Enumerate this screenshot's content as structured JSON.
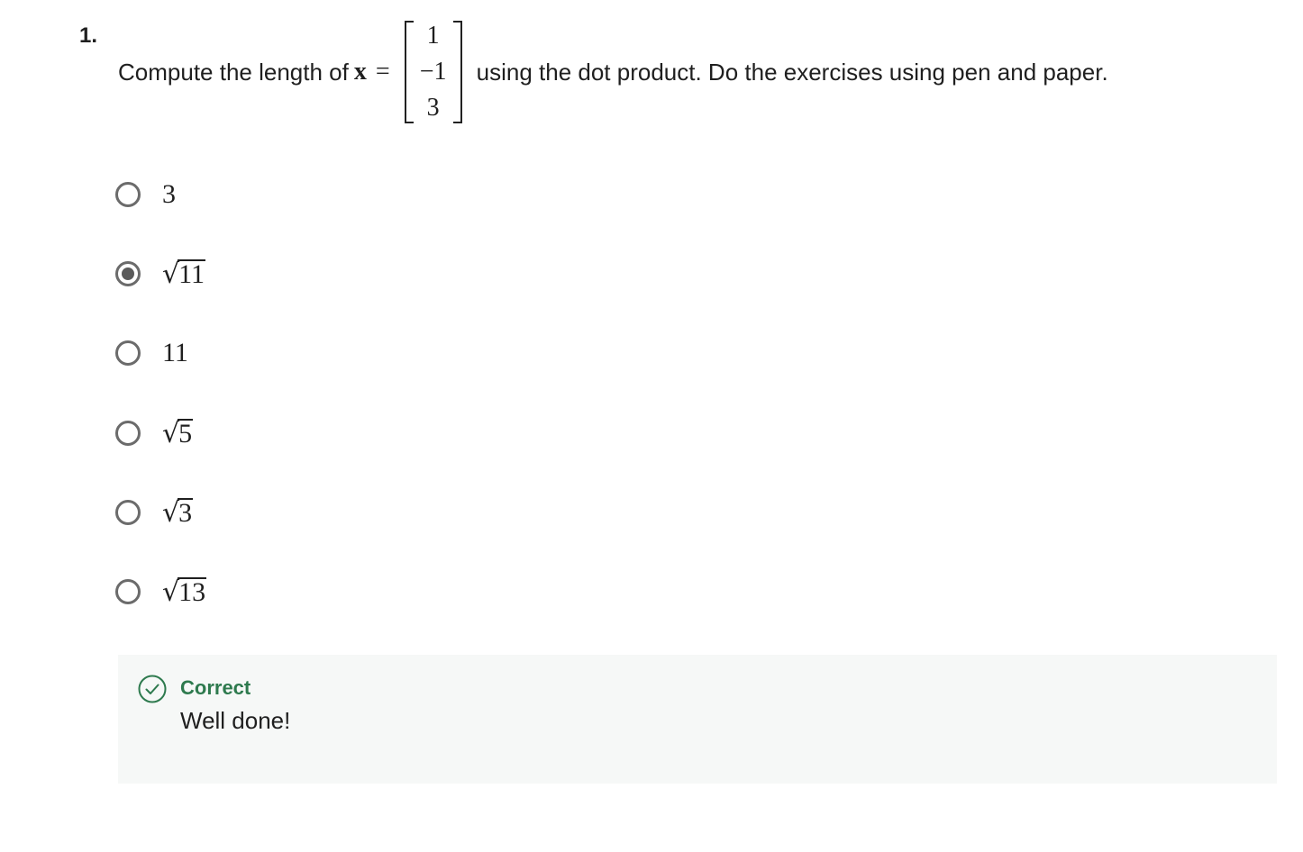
{
  "question": {
    "number": "1.",
    "prompt_prefix": "Compute the length of",
    "variable": "x",
    "equals": "=",
    "vector": [
      "1",
      "−1",
      "3"
    ],
    "prompt_suffix": "using the dot product. Do the exercises using pen and paper."
  },
  "options": [
    {
      "sqrt": false,
      "value": "3",
      "checked": false
    },
    {
      "sqrt": true,
      "value": "11",
      "checked": true
    },
    {
      "sqrt": false,
      "value": "11",
      "checked": false
    },
    {
      "sqrt": true,
      "value": "5",
      "checked": false
    },
    {
      "sqrt": true,
      "value": "3",
      "checked": false
    },
    {
      "sqrt": true,
      "value": "13",
      "checked": false
    }
  ],
  "feedback": {
    "status": "Correct",
    "message": "Well done!",
    "icon": "check-circle-icon",
    "accent_color": "#2e7a4e"
  },
  "radio_symbol": "√"
}
